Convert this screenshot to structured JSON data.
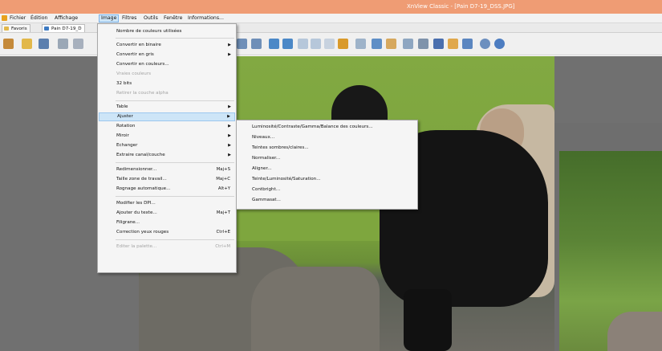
{
  "window": {
    "title": "XnView Classic - [Pain D7-19_DSS.JPG]"
  },
  "menubar": {
    "items": [
      {
        "label": "Fichier",
        "active": false
      },
      {
        "label": "Édition",
        "active": false
      },
      {
        "label": "Affichage",
        "active": false
      },
      {
        "label": "Image",
        "active": true
      },
      {
        "label": "Filtres",
        "active": false
      },
      {
        "label": "Outils",
        "active": false
      },
      {
        "label": "Fenêtre",
        "active": false
      },
      {
        "label": "Informations...",
        "active": false
      }
    ]
  },
  "tabs": [
    {
      "label": "Favoris",
      "icon": "folder-icon"
    },
    {
      "label": "Pain D7-19_D",
      "icon": "image-icon"
    }
  ],
  "toolbar": {
    "icons": [
      "open-icon",
      "browse-icon",
      "save-icon",
      "print-icon",
      "fit-icon",
      "zoom-in-icon",
      "zoom-out-icon",
      "prev-icon",
      "next-icon",
      "rotate-left-icon",
      "rotate-right-icon",
      "crop-icon",
      "filter-icon",
      "settings-icon",
      "slideshow-icon",
      "capture-icon",
      "search-icon",
      "print-icon",
      "monitor-icon",
      "screen-icon",
      "capture-icon",
      "info-icon",
      "help-icon"
    ]
  },
  "image_menu": {
    "items": [
      {
        "label": "Nombre de couleurs utilisées",
        "shortcut": "",
        "submenu": false,
        "disabled": false,
        "highlight": false
      },
      {
        "label": "Convertir en binaire",
        "shortcut": "",
        "submenu": true,
        "disabled": false,
        "highlight": false
      },
      {
        "label": "Convertir en gris",
        "shortcut": "",
        "submenu": true,
        "disabled": false,
        "highlight": false
      },
      {
        "label": "Convertir en couleurs...",
        "shortcut": "",
        "submenu": false,
        "disabled": false,
        "highlight": false
      },
      {
        "label": "Vraies couleurs",
        "shortcut": "",
        "submenu": false,
        "disabled": true,
        "highlight": false
      },
      {
        "label": "32 bits",
        "shortcut": "",
        "submenu": false,
        "disabled": false,
        "highlight": false
      },
      {
        "label": "Retirer la couche alpha",
        "shortcut": "",
        "submenu": false,
        "disabled": true,
        "highlight": false
      },
      {
        "label": "Table",
        "shortcut": "",
        "submenu": true,
        "disabled": false,
        "highlight": false
      },
      {
        "label": "Ajuster",
        "shortcut": "",
        "submenu": true,
        "disabled": false,
        "highlight": true
      },
      {
        "label": "Rotation",
        "shortcut": "",
        "submenu": true,
        "disabled": false,
        "highlight": false
      },
      {
        "label": "Miroir",
        "shortcut": "",
        "submenu": true,
        "disabled": false,
        "highlight": false
      },
      {
        "label": "Echanger",
        "shortcut": "",
        "submenu": true,
        "disabled": false,
        "highlight": false
      },
      {
        "label": "Extraire canal/couche",
        "shortcut": "",
        "submenu": true,
        "disabled": false,
        "highlight": false
      },
      {
        "label": "Redimensionner...",
        "shortcut": "Maj+S",
        "submenu": false,
        "disabled": false,
        "highlight": false
      },
      {
        "label": "Taille zone de travail...",
        "shortcut": "Maj+C",
        "submenu": false,
        "disabled": false,
        "highlight": false
      },
      {
        "label": "Rognage automatique...",
        "shortcut": "Alt+Y",
        "submenu": false,
        "disabled": false,
        "highlight": false
      },
      {
        "label": "Modifier les DPI...",
        "shortcut": "",
        "submenu": false,
        "disabled": false,
        "highlight": false
      },
      {
        "label": "Ajouter du texte...",
        "shortcut": "Maj+T",
        "submenu": false,
        "disabled": false,
        "highlight": false
      },
      {
        "label": "Filigrane...",
        "shortcut": "",
        "submenu": false,
        "disabled": false,
        "highlight": false
      },
      {
        "label": "Correction yeux rouges",
        "shortcut": "Ctrl+E",
        "submenu": false,
        "disabled": false,
        "highlight": false
      },
      {
        "label": "Editer la palette...",
        "shortcut": "Ctrl+M",
        "submenu": false,
        "disabled": true,
        "highlight": false
      }
    ]
  },
  "adjust_menu": {
    "items": [
      {
        "label": "Luminosité/Contraste/Gamma/Balance des couleurs..."
      },
      {
        "label": "Niveaux..."
      },
      {
        "label": "Teintes sombres/claires..."
      },
      {
        "label": "Normaliser..."
      },
      {
        "label": "Aligner..."
      },
      {
        "label": "Teinte/Luminosité/Saturation..."
      },
      {
        "label": "Contbright..."
      },
      {
        "label": "Gammasat..."
      }
    ]
  },
  "colors": {
    "titlebar": "#ef9c74",
    "menu_highlight": "#cde5f7",
    "menu_bg": "#f5f5f5",
    "viewer_bg": "#707070"
  }
}
